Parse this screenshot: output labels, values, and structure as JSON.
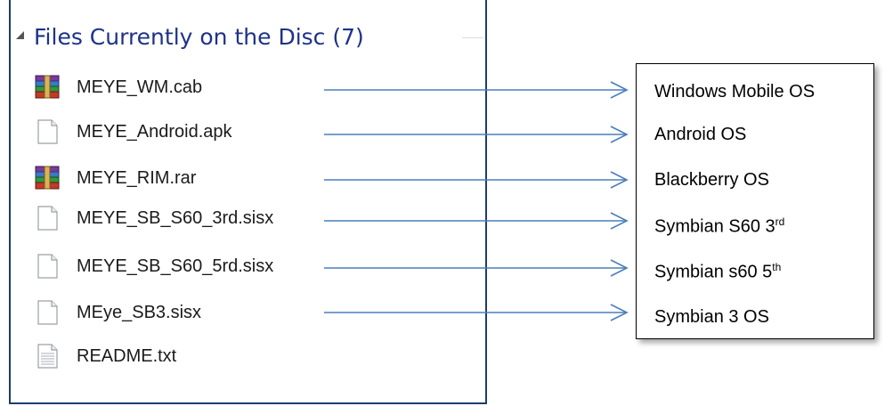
{
  "group": {
    "title": "Files Currently on the Disc (7)"
  },
  "files": [
    {
      "name": "MEYE_WM.cab",
      "icon": "winrar-archive-icon"
    },
    {
      "name": "MEYE_Android.apk",
      "icon": "blank-file-icon"
    },
    {
      "name": "MEYE_RIM.rar",
      "icon": "winrar-archive-icon"
    },
    {
      "name": "MEYE_SB_S60_3rd.sisx",
      "icon": "blank-file-icon"
    },
    {
      "name": "MEYE_SB_S60_5rd.sisx",
      "icon": "blank-file-icon"
    },
    {
      "name": "MEye_SB3.sisx",
      "icon": "blank-file-icon"
    },
    {
      "name": "README.txt",
      "icon": "text-file-icon"
    }
  ],
  "targets": [
    {
      "label": "Windows Mobile OS",
      "sup": ""
    },
    {
      "label": "Android OS",
      "sup": ""
    },
    {
      "label": "Blackberry OS",
      "sup": ""
    },
    {
      "label": "Symbian S60 3",
      "sup": "rd"
    },
    {
      "label": "Symbian s60 5",
      "sup": "th"
    },
    {
      "label": "Symbian 3 OS",
      "sup": ""
    }
  ],
  "colors": {
    "arrow": "#4a7ebb",
    "group_title": "#1e3287",
    "panel_border": "#1f3b6e"
  }
}
